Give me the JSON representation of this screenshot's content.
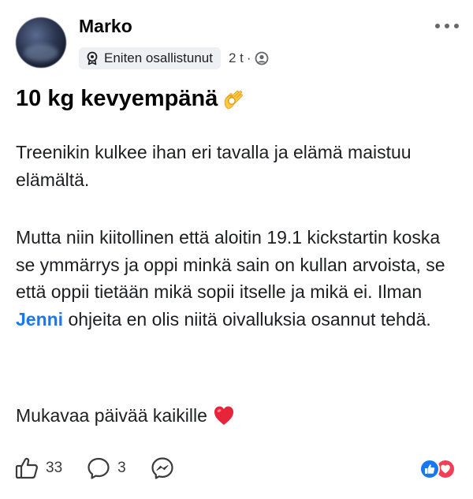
{
  "post": {
    "author": "Marko",
    "badge_label": "Eniten osallistunut",
    "time": "2 t",
    "separator": "·",
    "title": "10 kg kevyempänä",
    "paragraph1": "Treenikin kulkee ihan eri tavalla ja elämä maistuu elämältä.",
    "paragraph2_before": "Mutta niin kiitollinen että aloitin 19.1 kickstartin koska se ymmärrys ja oppi minkä sain on kullan arvoista, se että oppii tietään mikä sopii itselle ja mikä ei. Ilman ",
    "mention": "Jenni",
    "paragraph2_after": " ohjeita en olis niitä oivalluksia osannut tehdä.",
    "paragraph3": "Mukavaa päivää kaikille"
  },
  "actions": {
    "like_count": "33",
    "comment_count": "3"
  },
  "icons": {
    "badge": "medal-icon",
    "audience": "globe-icon",
    "more": "more-dots-icon",
    "title_emoji": "ok-hand-emoji",
    "closing_emoji": "red-heart-emoji",
    "like": "thumbs-up-icon",
    "comment": "comment-bubble-icon",
    "share": "messenger-icon",
    "reaction_like": "like-reaction-icon",
    "reaction_love": "love-reaction-icon"
  },
  "colors": {
    "mention": "#1877f2",
    "like_reaction": "#1877f2",
    "love_reaction": "#f33e58",
    "badge_bg": "#eef0f3",
    "secondary_text": "#65676b"
  }
}
